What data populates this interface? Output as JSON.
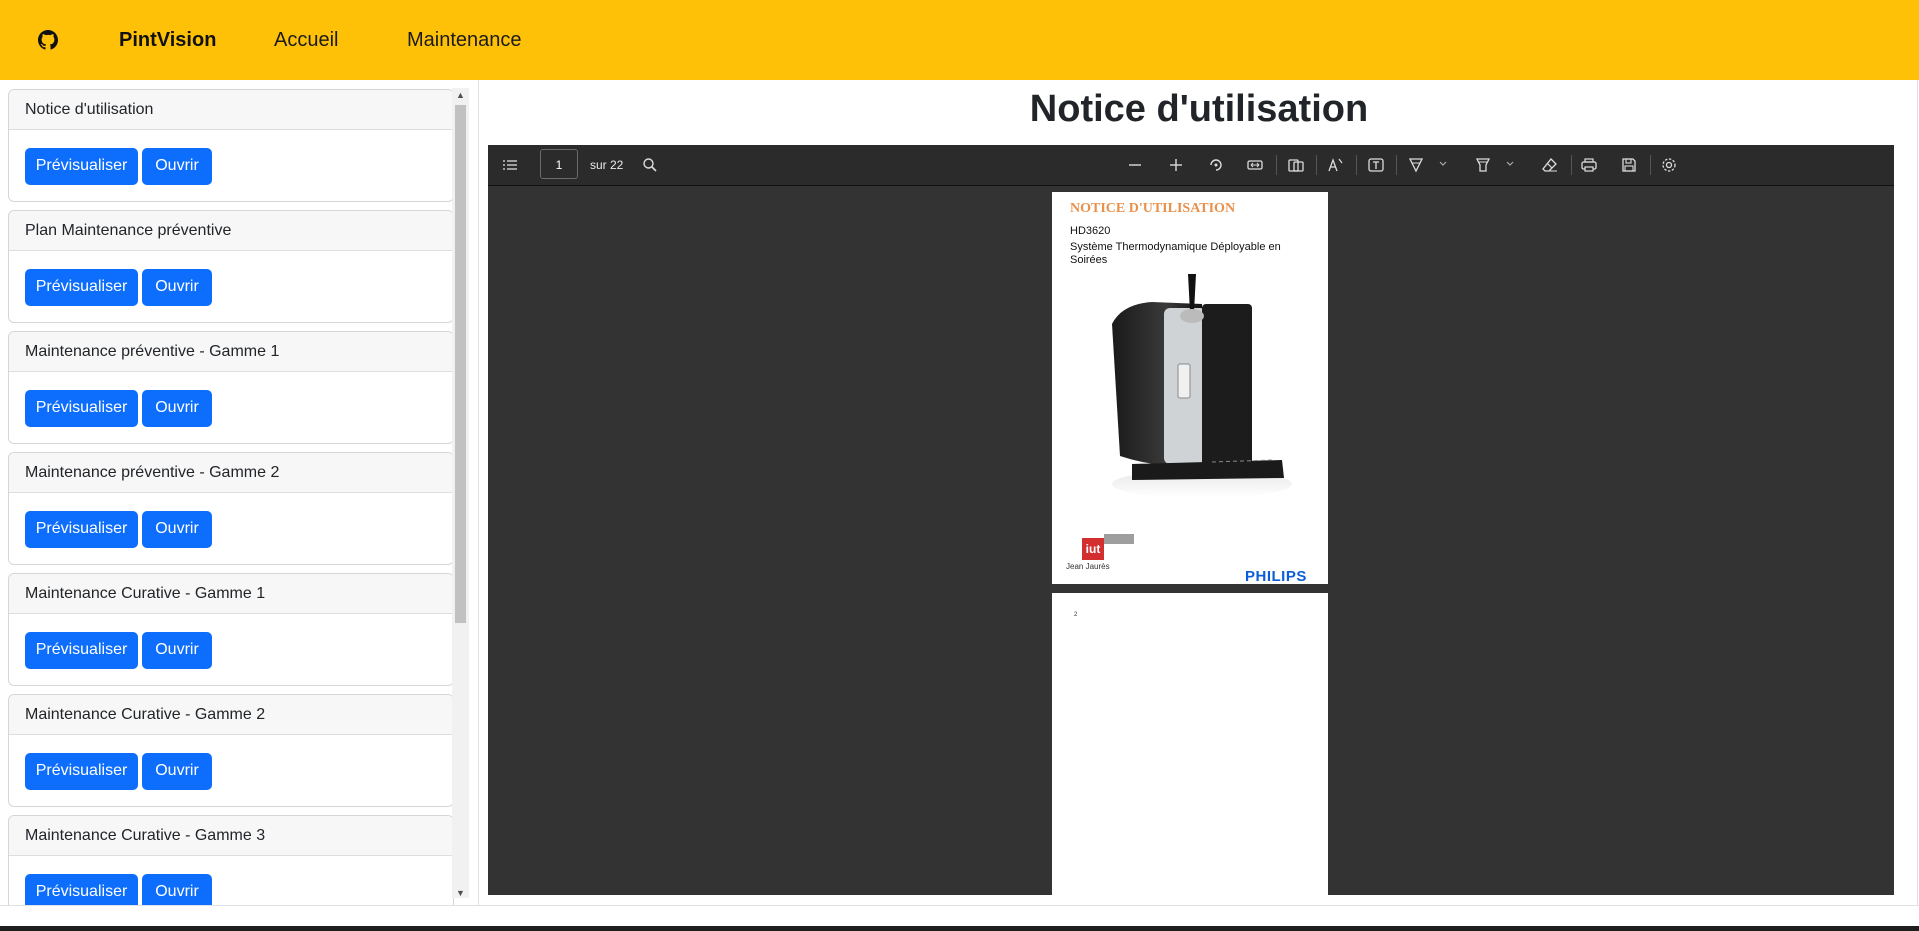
{
  "colors": {
    "navbar": "#ffc107",
    "primary_button": "#0d6efd",
    "viewer_bg": "#333333",
    "brand_orange": "#e8914d",
    "philips_blue": "#0b5ed7"
  },
  "navbar": {
    "github_icon": "github-icon",
    "brand": "PintVision",
    "links": [
      "Accueil",
      "Maintenance"
    ]
  },
  "documents": [
    {
      "title": "Notice d'utilisation",
      "preview_label": "Prévisualiser",
      "open_label": "Ouvrir"
    },
    {
      "title": "Plan Maintenance préventive",
      "preview_label": "Prévisualiser",
      "open_label": "Ouvrir"
    },
    {
      "title": "Maintenance préventive - Gamme 1",
      "preview_label": "Prévisualiser",
      "open_label": "Ouvrir"
    },
    {
      "title": "Maintenance préventive - Gamme 2",
      "preview_label": "Prévisualiser",
      "open_label": "Ouvrir"
    },
    {
      "title": "Maintenance Curative - Gamme 1",
      "preview_label": "Prévisualiser",
      "open_label": "Ouvrir"
    },
    {
      "title": "Maintenance Curative - Gamme 2",
      "preview_label": "Prévisualiser",
      "open_label": "Ouvrir"
    },
    {
      "title": "Maintenance Curative - Gamme 3",
      "preview_label": "Prévisualiser",
      "open_label": "Ouvrir"
    }
  ],
  "main": {
    "title": "Notice d'utilisation"
  },
  "viewer": {
    "current_page": "1",
    "page_count": "sur 22",
    "toolbar_icons": [
      "sidebar-toggle-icon",
      "search-icon",
      "zoom-out-icon",
      "zoom-in-icon",
      "rotate-icon",
      "fit-width-icon",
      "page-layout-icon",
      "text-highlight-icon",
      "text-box-icon",
      "draw-icon",
      "highlight-icon",
      "eraser-icon",
      "print-icon",
      "save-icon",
      "settings-icon"
    ],
    "page1": {
      "heading": "NOTICE D'UTILISATION",
      "model": "HD3620",
      "description": "Système Thermodynamique Déployable en Soirées",
      "logo_iut": "iut",
      "logo_university": "Jean Jaurès",
      "brand": "PHILIPS"
    },
    "page2": {
      "number": "2"
    }
  }
}
